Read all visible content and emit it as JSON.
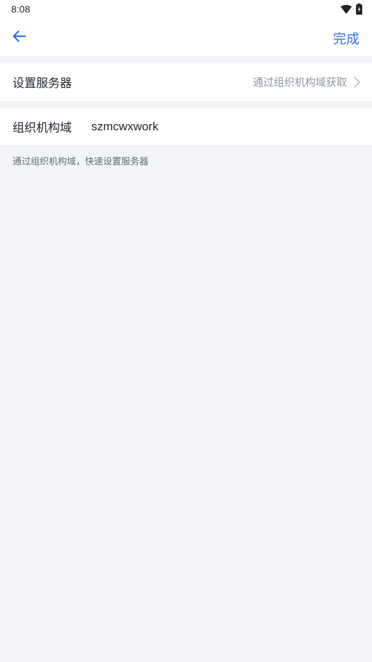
{
  "status_bar": {
    "time": "8:08",
    "wifi_icon": "wifi-icon",
    "battery_icon": "battery-charging-icon"
  },
  "nav": {
    "back_icon": "arrow-left-icon",
    "done_label": "完成"
  },
  "server_row": {
    "label": "设置服务器",
    "value": "通过组织机构域获取",
    "chevron_icon": "chevron-right-icon"
  },
  "domain_row": {
    "label": "组织机构域",
    "value": "szmcwxwork"
  },
  "hint_text": "通过组织机构域，快速设置服务器",
  "colors": {
    "accent": "#2f6fdc",
    "background": "#f3f4f7",
    "secondary_text": "#8f959e"
  }
}
